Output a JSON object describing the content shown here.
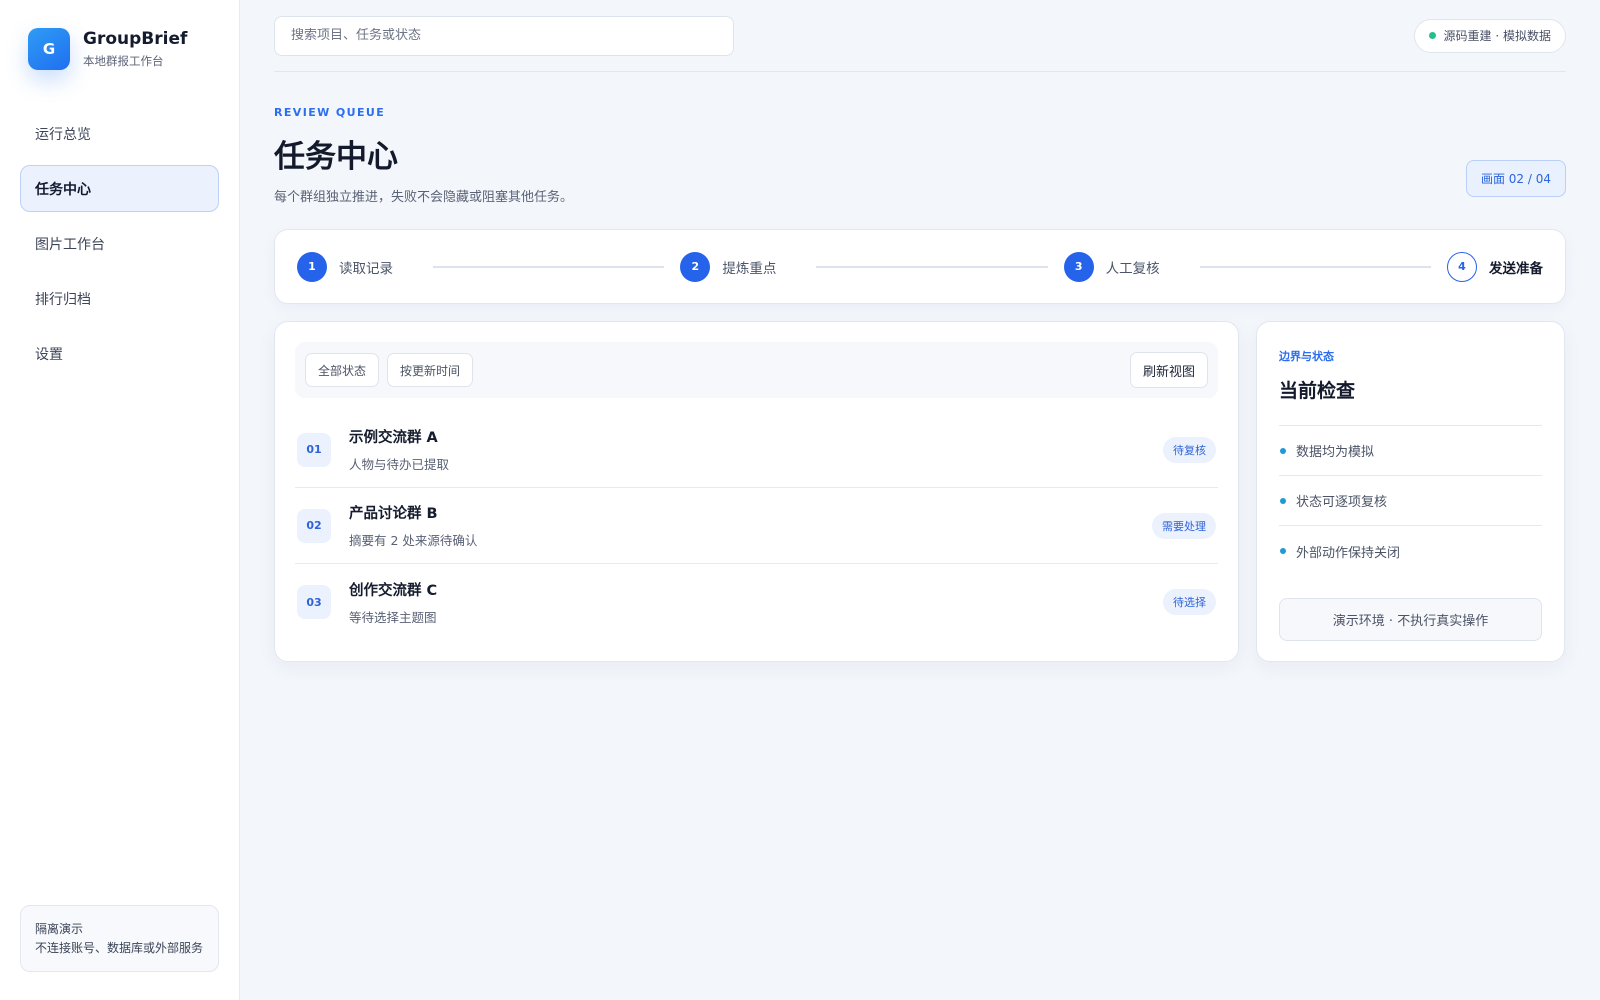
{
  "brand": {
    "logo_letter": "G",
    "name": "GroupBrief",
    "subtitle": "本地群报工作台"
  },
  "sidebar": {
    "items": [
      {
        "label": "运行总览",
        "active": false
      },
      {
        "label": "任务中心",
        "active": true
      },
      {
        "label": "图片工作台",
        "active": false
      },
      {
        "label": "排行归档",
        "active": false
      },
      {
        "label": "设置",
        "active": false
      }
    ],
    "footer": {
      "title": "隔离演示",
      "text": "不连接账号、数据库或外部服务"
    }
  },
  "topbar": {
    "search_placeholder": "搜索项目、任务或状态",
    "status_text": "源码重建 · 模拟数据",
    "status_color": "#22c08a"
  },
  "header": {
    "eyebrow": "REVIEW QUEUE",
    "title": "任务中心",
    "description": "每个群组独立推进，失败不会隐藏或阻塞其他任务。",
    "pager": "画面 02 / 04"
  },
  "steps": [
    {
      "num": "1",
      "label": "读取记录",
      "state": "done"
    },
    {
      "num": "2",
      "label": "提炼重点",
      "state": "done"
    },
    {
      "num": "3",
      "label": "人工复核",
      "state": "done"
    },
    {
      "num": "4",
      "label": "发送准备",
      "state": "current"
    }
  ],
  "queue": {
    "filters": [
      "全部状态",
      "按更新时间"
    ],
    "refresh_label": "刷新视图",
    "rows": [
      {
        "num": "01",
        "title": "示例交流群 A",
        "subtitle": "人物与待办已提取",
        "badge": "待复核"
      },
      {
        "num": "02",
        "title": "产品讨论群 B",
        "subtitle": "摘要有 2 处来源待确认",
        "badge": "需要处理"
      },
      {
        "num": "03",
        "title": "创作交流群 C",
        "subtitle": "等待选择主题图",
        "badge": "待选择"
      }
    ]
  },
  "checks": {
    "eyebrow": "边界与状态",
    "title": "当前检查",
    "items": [
      "数据均为模拟",
      "状态可逐项复核",
      "外部动作保持关闭"
    ],
    "footer": "演示环境 · 不执行真实操作"
  },
  "colors": {
    "accent": "#2563eb",
    "dot": "#1e9ad6"
  }
}
